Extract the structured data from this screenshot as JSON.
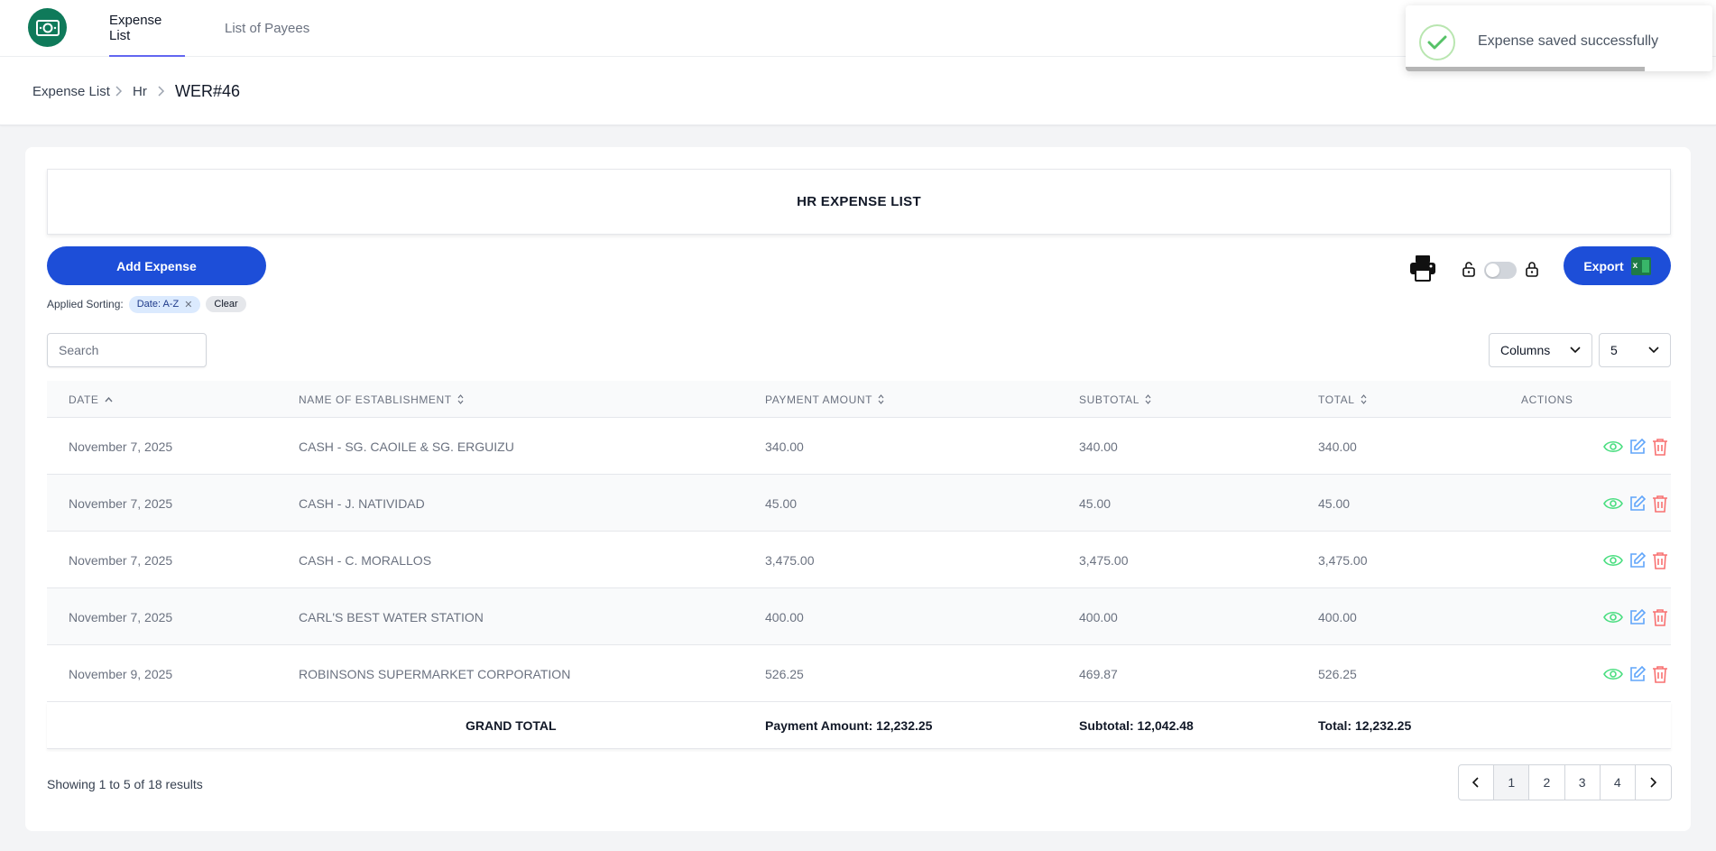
{
  "nav": {
    "logo_icon": "money-icon",
    "tabs": [
      {
        "label": "Expense List",
        "active": true
      },
      {
        "label": "List of Payees",
        "active": false
      }
    ]
  },
  "breadcrumb": {
    "items": [
      "Expense List",
      "Hr"
    ],
    "current": "WER#46"
  },
  "toast": {
    "message": "Expense saved successfully",
    "icon": "check-icon",
    "progress": 0.78
  },
  "page": {
    "title": "HR EXPENSE LIST",
    "add_button": "Add Expense",
    "export_button": "Export",
    "export_icon": "excel-icon",
    "lock_toggle_on": false
  },
  "sorting": {
    "label": "Applied Sorting:",
    "chip": "Date: A-Z",
    "clear": "Clear"
  },
  "controls": {
    "search_placeholder": "Search",
    "columns_label": "Columns",
    "rows_per_page": "5"
  },
  "table": {
    "headers": [
      {
        "label": "DATE",
        "sort": "asc"
      },
      {
        "label": "NAME OF ESTABLISHMENT",
        "sort": "both"
      },
      {
        "label": "PAYMENT AMOUNT",
        "sort": "both"
      },
      {
        "label": "SUBTOTAL",
        "sort": "both"
      },
      {
        "label": "TOTAL",
        "sort": "both"
      },
      {
        "label": "ACTIONS",
        "sort": "none"
      }
    ],
    "rows": [
      {
        "date": "November 7, 2025",
        "name": "CASH - SG. CAOILE & SG. ERGUIZU",
        "payment": "340.00",
        "subtotal": "340.00",
        "total": "340.00"
      },
      {
        "date": "November 7, 2025",
        "name": "CASH - J. NATIVIDAD",
        "payment": "45.00",
        "subtotal": "45.00",
        "total": "45.00"
      },
      {
        "date": "November 7, 2025",
        "name": "CASH - C. MORALLOS",
        "payment": "3,475.00",
        "subtotal": "3,475.00",
        "total": "3,475.00"
      },
      {
        "date": "November 7, 2025",
        "name": "CARL'S BEST WATER STATION",
        "payment": "400.00",
        "subtotal": "400.00",
        "total": "400.00"
      },
      {
        "date": "November 9, 2025",
        "name": "ROBINSONS SUPERMARKET CORPORATION",
        "payment": "526.25",
        "subtotal": "469.87",
        "total": "526.25"
      }
    ],
    "grand_total": {
      "label": "GRAND TOTAL",
      "payment": "Payment Amount: 12,232.25",
      "subtotal": "Subtotal: 12,042.48",
      "total": "Total: 12,232.25"
    }
  },
  "pagination": {
    "summary": "Showing 1 to 5 of 18 results",
    "pages": [
      "1",
      "2",
      "3",
      "4"
    ],
    "current": "1"
  },
  "colors": {
    "primary": "#1d4ed8",
    "view": "#4ade80",
    "edit": "#60a5fa",
    "delete": "#f87171",
    "logo": "#0f7a5a"
  }
}
